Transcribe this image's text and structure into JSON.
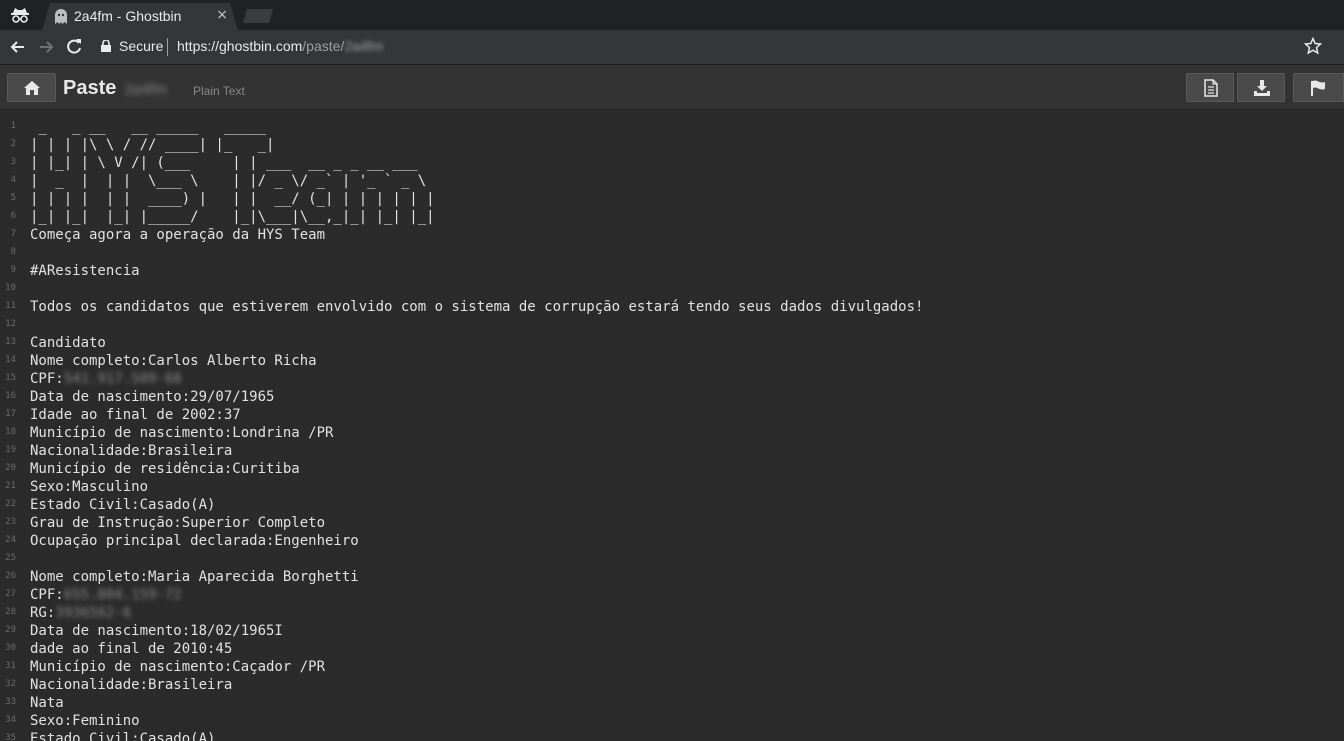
{
  "browser": {
    "tab_title": "2a4fm - Ghostbin",
    "tab_close": "×",
    "secure_label": "Secure",
    "url_host": "https://ghostbin.com",
    "url_path": "/paste/",
    "url_id": "2a4fm"
  },
  "header": {
    "title": "Paste",
    "paste_id": "2a4fm",
    "language": "Plain Text",
    "buttons": [
      "raw-icon",
      "download-icon",
      "report-flag-icon"
    ]
  },
  "code": {
    "lines": [
      {
        "n": "1",
        "t": " _   _ __   __ _____   _____"
      },
      {
        "n": "2",
        "t": "| | | |\\ \\ / // ____| |_   _|"
      },
      {
        "n": "3",
        "t": "| |_| | \\ V /| (___     | | ___  __ _ _ __ ___"
      },
      {
        "n": "4",
        "t": "|  _  |  | |  \\___ \\    | |/ _ \\/ _` | '_ ` _ \\"
      },
      {
        "n": "5",
        "t": "| | | |  | |  ____) |   | |  __/ (_| | | | | | |"
      },
      {
        "n": "6",
        "t": "|_| |_|  |_| |_____/    |_|\\___|\\__,_|_| |_| |_|"
      },
      {
        "n": "7",
        "t": "Começa agora a operação da HYS Team"
      },
      {
        "n": "8",
        "t": ""
      },
      {
        "n": "9",
        "t": "#AResistencia"
      },
      {
        "n": "10",
        "t": ""
      },
      {
        "n": "11",
        "t": "Todos os candidatos que estiverem envolvido com o sistema de corrupção estará tendo seus dados divulgados!"
      },
      {
        "n": "12",
        "t": ""
      },
      {
        "n": "13",
        "t": "Candidato"
      },
      {
        "n": "14",
        "t": "Nome completo:Carlos Alberto Richa"
      },
      {
        "n": "15",
        "t": "CPF:",
        "blur": "541.917.509-68"
      },
      {
        "n": "16",
        "t": "Data de nascimento:29/07/1965"
      },
      {
        "n": "17",
        "t": "Idade ao final de 2002:37"
      },
      {
        "n": "18",
        "t": "Município de nascimento:Londrina /PR"
      },
      {
        "n": "19",
        "t": "Nacionalidade:Brasileira"
      },
      {
        "n": "20",
        "t": "Município de residência:Curitiba"
      },
      {
        "n": "21",
        "t": "Sexo:Masculino"
      },
      {
        "n": "22",
        "t": "Estado Civil:Casado(A)"
      },
      {
        "n": "23",
        "t": "Grau de Instrução:Superior Completo"
      },
      {
        "n": "24",
        "t": "Ocupação principal declarada:Engenheiro"
      },
      {
        "n": "25",
        "t": ""
      },
      {
        "n": "26",
        "t": "Nome completo:Maria Aparecida Borghetti"
      },
      {
        "n": "27",
        "t": "CPF:",
        "blur": "655.804.159-72"
      },
      {
        "n": "28",
        "t": "RG:",
        "blur": "3936562-6"
      },
      {
        "n": "29",
        "t": "Data de nascimento:18/02/1965I"
      },
      {
        "n": "30",
        "t": "dade ao final de 2010:45"
      },
      {
        "n": "31",
        "t": "Município de nascimento:Caçador /PR"
      },
      {
        "n": "32",
        "t": "Nacionalidade:Brasileira"
      },
      {
        "n": "33",
        "t": "Nata"
      },
      {
        "n": "34",
        "t": "Sexo:Feminino"
      },
      {
        "n": "35",
        "t": "Estado Civil:Casado(A)"
      }
    ]
  }
}
